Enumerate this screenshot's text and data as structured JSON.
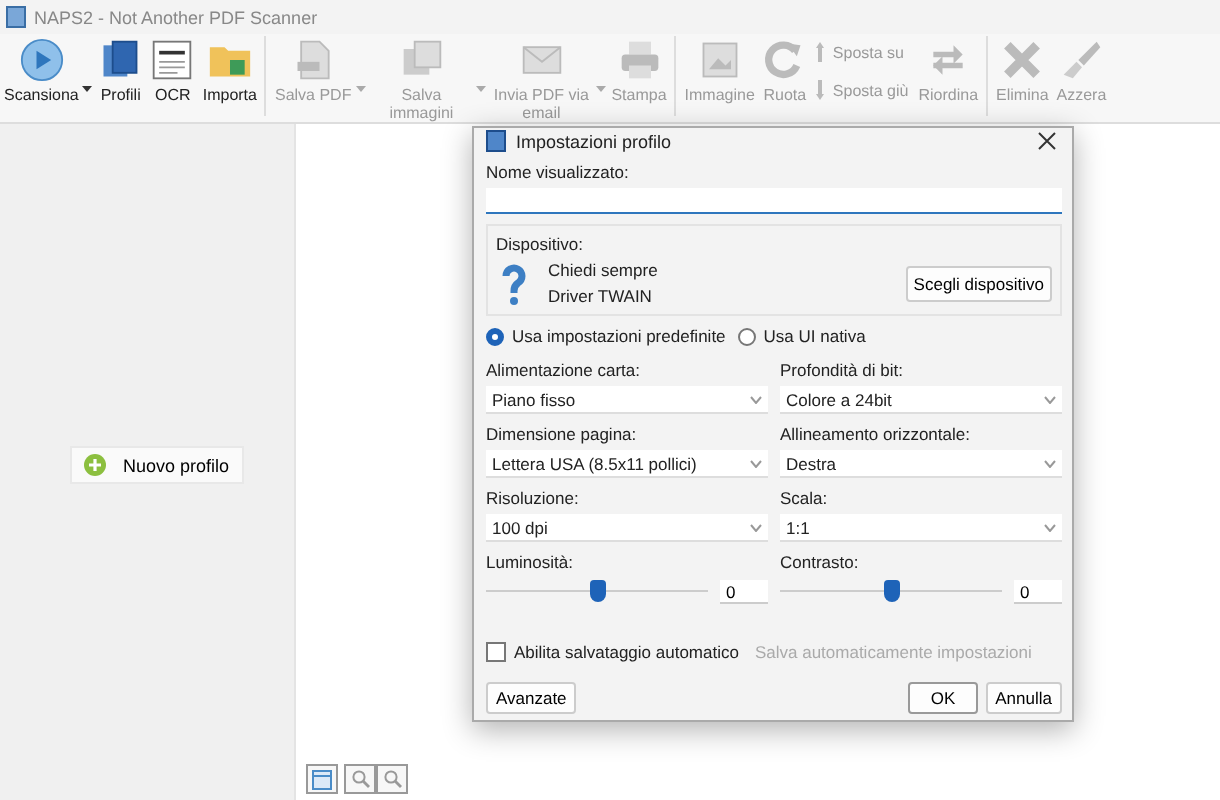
{
  "window": {
    "title": "NAPS2 - Not Another PDF Scanner"
  },
  "toolbar": [
    {
      "kind": "button",
      "label": "Scansiona",
      "disabled": false,
      "dropdown": true,
      "separator_before": false
    },
    {
      "kind": "button",
      "label": "Profili",
      "disabled": false,
      "dropdown": false,
      "separator_before": false
    },
    {
      "kind": "button",
      "label": "OCR",
      "disabled": false,
      "dropdown": false,
      "separator_before": false
    },
    {
      "kind": "button",
      "label": "Importa",
      "disabled": false,
      "dropdown": false,
      "separator_before": false
    },
    {
      "kind": "button",
      "label": "Salva PDF",
      "disabled": true,
      "dropdown": true,
      "separator_before": true
    },
    {
      "kind": "button",
      "label": "Salva immagini",
      "disabled": true,
      "dropdown": true,
      "separator_before": false
    },
    {
      "kind": "button",
      "label": "Invia PDF via email",
      "disabled": true,
      "dropdown": true,
      "separator_before": false
    },
    {
      "kind": "button",
      "label": "Stampa",
      "disabled": true,
      "dropdown": false,
      "separator_before": false
    },
    {
      "kind": "button",
      "label": "Immagine",
      "disabled": true,
      "dropdown": false,
      "separator_before": true
    },
    {
      "kind": "button",
      "label": "Ruota",
      "disabled": true,
      "dropdown": false,
      "separator_before": false
    },
    {
      "kind": "stack",
      "labels": [
        "Sposta su",
        "Sposta giù"
      ],
      "disabled": true,
      "separator_before": false
    },
    {
      "kind": "button",
      "label": "Riordina",
      "disabled": true,
      "dropdown": false,
      "separator_before": false
    },
    {
      "kind": "button",
      "label": "Elimina",
      "disabled": true,
      "dropdown": false,
      "separator_before": true
    },
    {
      "kind": "button",
      "label": "Azzera",
      "disabled": true,
      "dropdown": false,
      "separator_before": false
    }
  ],
  "profiles_pane": {
    "new_profile_button": "Nuovo profilo"
  },
  "dialog": {
    "title": "Impostazioni profilo",
    "name_label": "Nome visualizzato:",
    "device": {
      "label": "Dispositivo:",
      "lines": [
        "Chiedi sempre",
        "Driver TWAIN"
      ],
      "button": "Scegli dispositivo"
    },
    "modes": [
      {
        "label": "Usa impostazioni predefinite",
        "selected": true
      },
      {
        "label": "Usa UI nativa",
        "selected": false
      }
    ],
    "fields": [
      {
        "kind": "select",
        "label": "Alimentazione carta:",
        "value": "Piano fisso"
      },
      {
        "kind": "select",
        "label": "Profondità di bit:",
        "value": "Colore a 24bit"
      },
      {
        "kind": "select",
        "label": "Dimensione pagina:",
        "value": "Lettera USA (8.5x11 pollici)"
      },
      {
        "kind": "select",
        "label": "Allineamento orizzontale:",
        "value": "Destra"
      },
      {
        "kind": "select",
        "label": "Risoluzione:",
        "value": "100 dpi"
      },
      {
        "kind": "select",
        "label": "Scala:",
        "value": "1:1"
      },
      {
        "kind": "slider",
        "label": "Luminosità:",
        "level": 0.5,
        "value": "0"
      },
      {
        "kind": "slider",
        "label": "Contrasto:",
        "level": 0.5,
        "value": "0"
      }
    ],
    "autosave": {
      "label": "Abilita salvataggio automatico",
      "checked": false
    },
    "autosave_settings": {
      "label": "Salva automaticamente impostazioni",
      "disabled": true
    },
    "buttons": {
      "advanced": "Avanzate",
      "ok": "OK",
      "cancel": "Annulla"
    }
  }
}
